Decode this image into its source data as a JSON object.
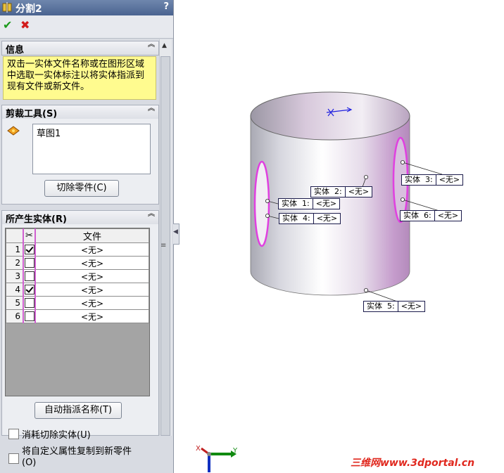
{
  "titlebar": {
    "title": "分割2",
    "help": "?"
  },
  "actions": {
    "ok_label": "✔",
    "cancel_label": "✖"
  },
  "info": {
    "header": "信息",
    "text": "双击一实体文件名称或在图形区域中选取一实体标注以将实体指派到现有文件或新文件。"
  },
  "trim_tools": {
    "header": "剪裁工具(S)",
    "item": "草图1",
    "button": "切除零件(C)"
  },
  "resulting_bodies": {
    "header": "所产生实体(R)",
    "column_file": "文件",
    "rows": [
      {
        "num": "1",
        "checked": true,
        "file": "<无>"
      },
      {
        "num": "2",
        "checked": false,
        "file": "<无>"
      },
      {
        "num": "3",
        "checked": false,
        "file": "<无>"
      },
      {
        "num": "4",
        "checked": true,
        "file": "<无>"
      },
      {
        "num": "5",
        "checked": false,
        "file": "<无>"
      },
      {
        "num": "6",
        "checked": false,
        "file": "<无>"
      }
    ],
    "auto_assign_button": "自动指派名称(T)",
    "consume_label": "消耗切除实体(U)",
    "copy_props_label": "将自定义属性复制到新零件(O)"
  },
  "callouts": [
    {
      "id": "1",
      "name": "实体  1:",
      "value": "<无>"
    },
    {
      "id": "2",
      "name": "实体  2:",
      "value": "<无>"
    },
    {
      "id": "3",
      "name": "实体  3:",
      "value": "<无>"
    },
    {
      "id": "4",
      "name": "实体  4:",
      "value": "<无>"
    },
    {
      "id": "5",
      "name": "实体  5:",
      "value": "<无>"
    },
    {
      "id": "6",
      "name": "实体  6:",
      "value": "<无>"
    }
  ],
  "triad": {
    "x": "X",
    "y": "Y"
  },
  "watermark": "三维网www.3dportal.cn",
  "colors": {
    "title_bar": "#4a6390",
    "info_bg": "#fffb8f",
    "highlight": "#d060d0",
    "callout_border": "#1b1b4b",
    "watermark": "#e0281e"
  }
}
